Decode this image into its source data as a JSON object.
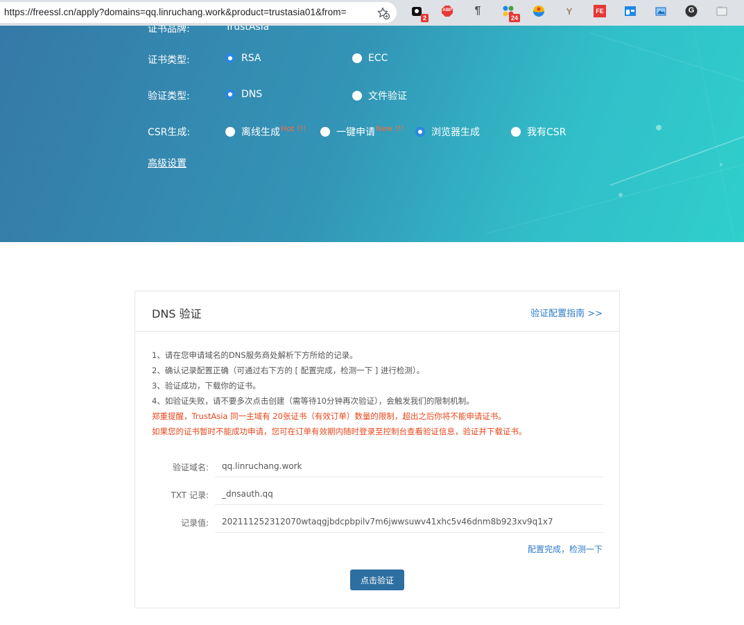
{
  "browser": {
    "url": "https://freessl.cn/apply?domains=qq.linruchang.work&product=trustasia01&from=",
    "extensions": [
      {
        "icon": "pocket-icon",
        "badge": "2"
      },
      {
        "icon": "adblock-icon",
        "label": "ABP"
      },
      {
        "icon": "paragraph-icon",
        "label": "¶"
      },
      {
        "icon": "grid-apps-icon",
        "badge": "24"
      },
      {
        "icon": "globe-icon"
      },
      {
        "icon": "y-logo-icon",
        "label": "Y"
      },
      {
        "icon": "fe-icon",
        "label": "FE"
      },
      {
        "icon": "window-icon"
      },
      {
        "icon": "screenshot-icon"
      },
      {
        "icon": "g-icon",
        "label": "G"
      },
      {
        "icon": "folder-icon"
      }
    ]
  },
  "form": {
    "brand_label": "证书品牌:",
    "brand_value": "TrustAsia",
    "cert_type": {
      "label": "证书类型:",
      "options": [
        "RSA",
        "ECC"
      ],
      "selected": "RSA"
    },
    "verify_type": {
      "label": "验证类型:",
      "options": [
        "DNS",
        "文件验证"
      ],
      "selected": "DNS"
    },
    "csr": {
      "label": "CSR生成:",
      "options": [
        {
          "text": "离线生成",
          "tag": "Hot !!!"
        },
        {
          "text": "一键申请",
          "tag": "New !!!"
        },
        {
          "text": "浏览器生成",
          "tag": ""
        },
        {
          "text": "我有CSR",
          "tag": ""
        }
      ],
      "selected": "浏览器生成"
    },
    "advanced_link": "高级设置"
  },
  "dns_panel": {
    "title": "DNS 验证",
    "guide_link": "验证配置指南 >>",
    "instructions": [
      "1、请在您申请域名的DNS服务商处解析下方所给的记录。",
      "2、确认记录配置正确（可通过右下方的 [ 配置完成，检测一下 ] 进行检测）。",
      "3、验证成功，下载你的证书。",
      "4、如验证失败，请不要多次点击创建（需等待10分钟再次验证），会触发我们的限制机制。"
    ],
    "warnings": [
      "郑重提醒，TrustAsia 同一主域有 20张证书（有效订单）数量的限制，超出之后你将不能申请证书。",
      "如果您的证书暂时不能成功申请，您可在订单有效期内随时登录至控制台查看验证信息，验证并下载证书。"
    ],
    "fields": [
      {
        "label": "验证域名:",
        "value": "qq.linruchang.work"
      },
      {
        "label": "TXT 记录:",
        "value": "_dnsauth.qq"
      },
      {
        "label": "记录值:",
        "value": "202111252312070wtaqgjbdcpbpilv7m6jwwsuwv41xhc5v46dnm8b923xv9q1x7"
      }
    ],
    "check_link": "配置完成，检测一下",
    "verify_button": "点击验证"
  },
  "colors": {
    "accent": "#2b86e0",
    "link": "#2d7bc6",
    "warning": "#e8461b",
    "button": "#2e6fa1",
    "hero_start": "#3579a7",
    "hero_end": "#2fcfcc"
  }
}
